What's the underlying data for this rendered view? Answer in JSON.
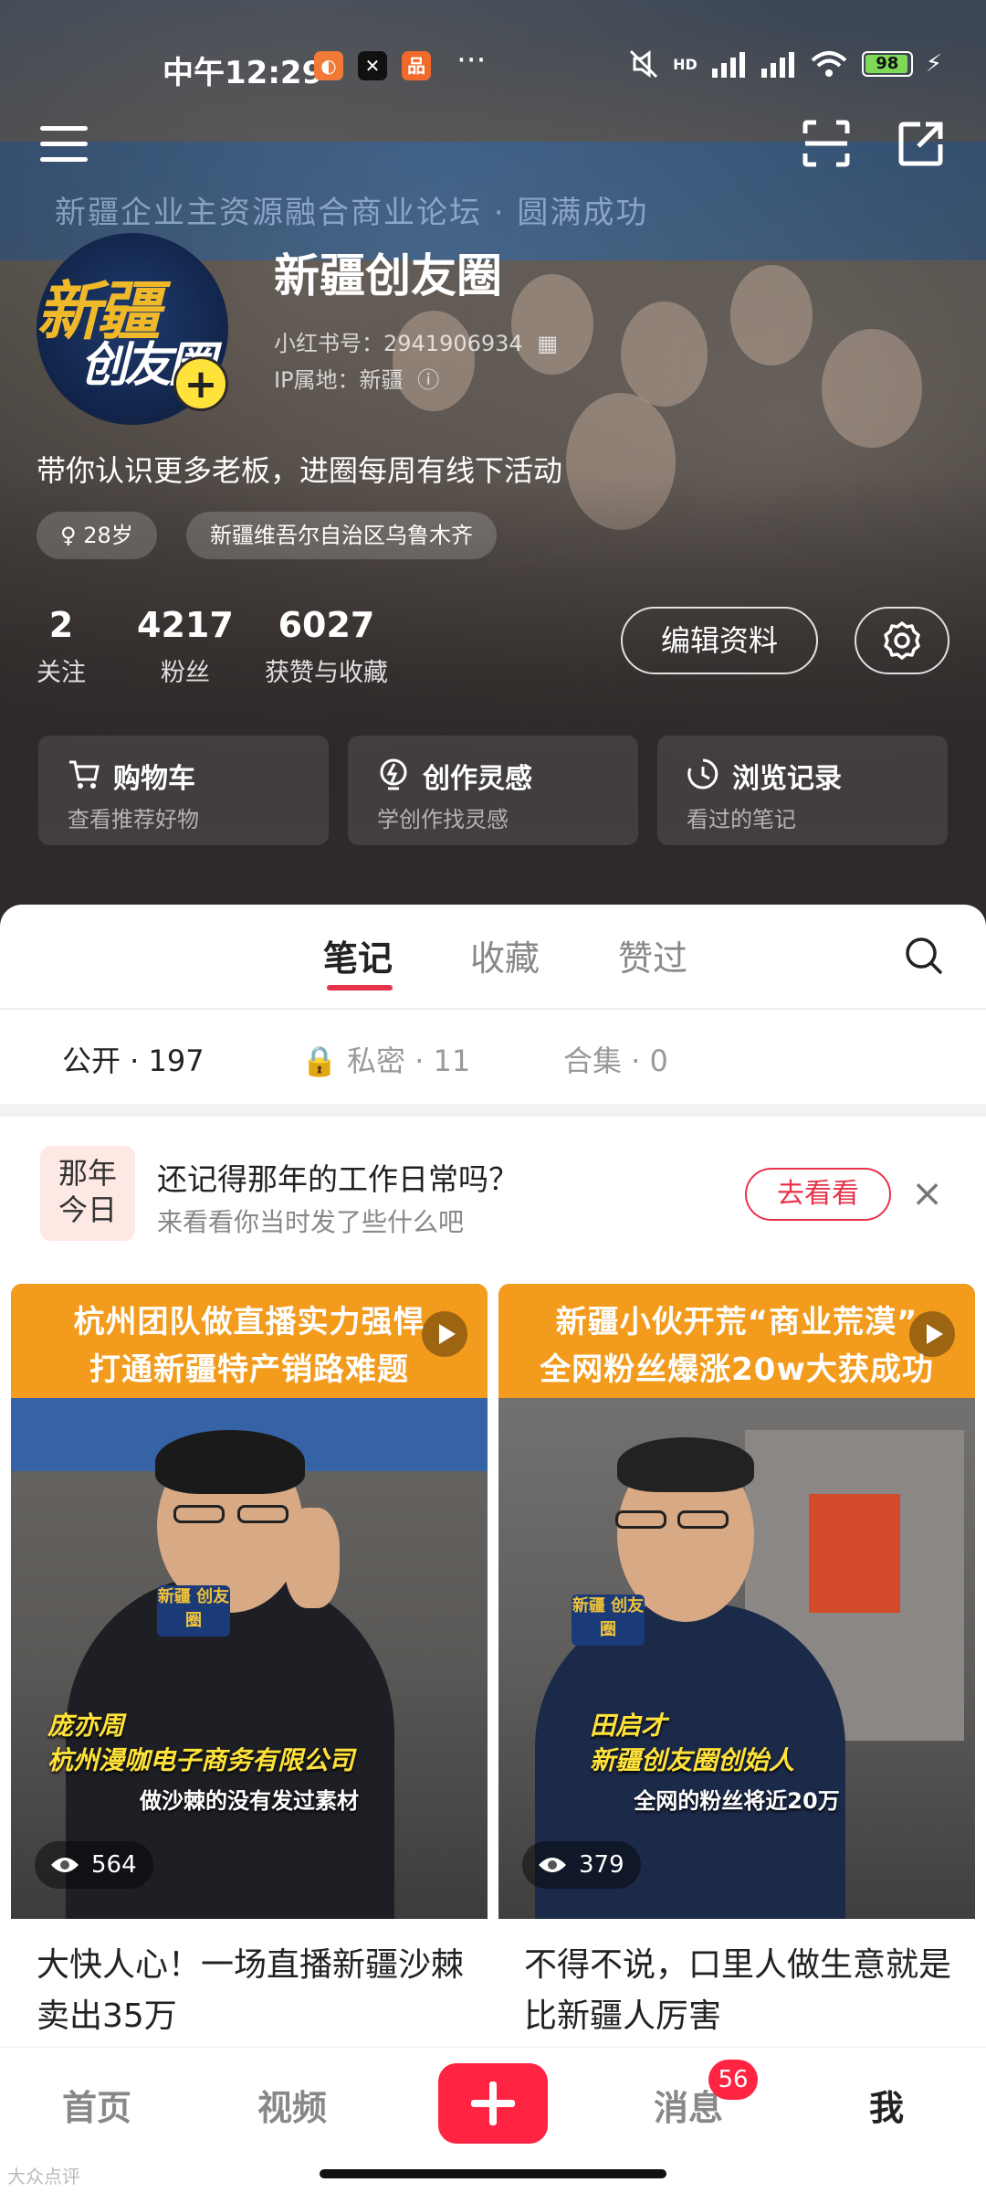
{
  "status_bar": {
    "time": "中午12:29",
    "dots": "···",
    "network": "HD",
    "battery": "98"
  },
  "hero": {
    "banner_text": "新疆企业主资源融合商业论坛 · 圆满成功"
  },
  "profile": {
    "avatar_text_top": "新疆",
    "avatar_text_bottom": "创友圈",
    "nickname": "新疆创友圈",
    "id_line": "小红书号：2941906934",
    "ip_line": "IP属地：新疆",
    "bio": "带你认识更多老板，进圈每周有线下活动",
    "tags": [
      "♀ 28岁",
      "新疆维吾尔自治区乌鲁木齐"
    ],
    "stats": [
      {
        "num": "2",
        "label": "关注"
      },
      {
        "num": "4217",
        "label": "粉丝"
      },
      {
        "num": "6027",
        "label": "获赞与收藏"
      }
    ],
    "edit_label": "编辑资料"
  },
  "quick_links": [
    {
      "title": "购物车",
      "sub": "查看推荐好物",
      "icon": "cart-icon"
    },
    {
      "title": "创作灵感",
      "sub": "学创作找灵感",
      "icon": "bulb-icon"
    },
    {
      "title": "浏览记录",
      "sub": "看过的笔记",
      "icon": "clock-icon"
    }
  ],
  "tabs": [
    "笔记",
    "收藏",
    "赞过"
  ],
  "subtabs": [
    "公开 · 197",
    "私密 · 11",
    "合集 · 0"
  ],
  "memory": {
    "badge_top": "那年",
    "badge_bottom": "今日",
    "title": "还记得那年的工作日常吗？",
    "sub": "来看看你当时发了些什么吧",
    "button": "去看看",
    "close": "×"
  },
  "cards": [
    {
      "head_line1": "杭州团队做直播实力强悍",
      "head_line2": "打通新疆特产销路难题",
      "mic_text": "新疆 创友圈",
      "caption_name": "庞亦周",
      "caption_company": "杭州漫咖电子商务有限公司",
      "caption_sub": "做沙棘的没有发过素材",
      "views": "564",
      "title": "大快人心！一场直播新疆沙棘卖出35万"
    },
    {
      "head_line1": "新疆小伙开荒“商业荒漠”",
      "head_line2": "全网粉丝爆涨20w大获成功",
      "mic_text": "新疆 创友圈",
      "caption_name": "田启才",
      "caption_company": "新疆创友圈创始人",
      "caption_sub": "全网的粉丝将近20万",
      "views": "379",
      "title": "不得不说，口里人做生意就是比新疆人厉害"
    }
  ],
  "nav": {
    "items": [
      "首页",
      "视频",
      "消息",
      "我"
    ],
    "message_badge": "56"
  },
  "watermark": "大众点评",
  "colors": {
    "accent": "#ff2442",
    "tab_underline": "#e8334a",
    "card_header": "#f29b1c"
  }
}
